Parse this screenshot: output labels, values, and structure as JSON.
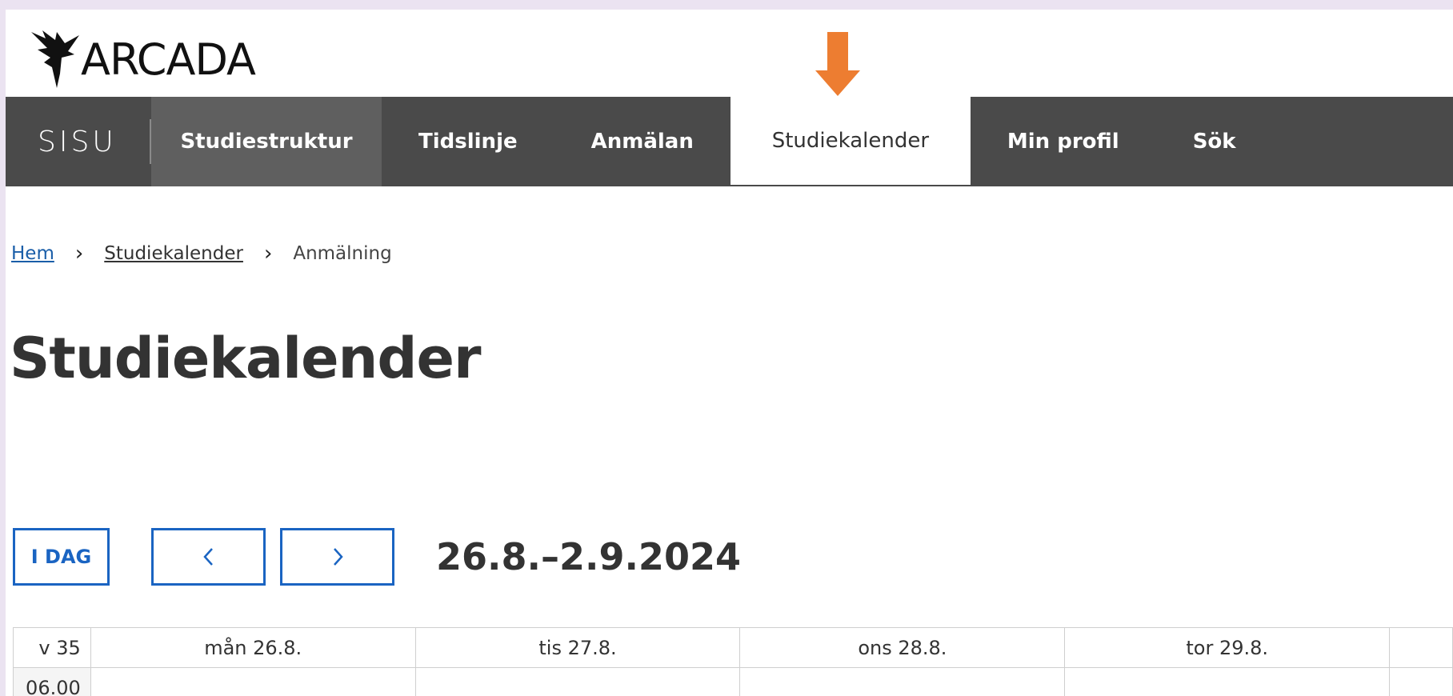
{
  "logo": {
    "text": "ARCADA",
    "icon": "arcada-bird-logo"
  },
  "annotation": {
    "icon": "orange-down-arrow",
    "color": "#ed7d31"
  },
  "nav": {
    "brand": "SISU",
    "items": [
      {
        "label": "Studiestruktur"
      },
      {
        "label": "Tidslinje"
      },
      {
        "label": "Anmälan"
      },
      {
        "label": "Studiekalender"
      },
      {
        "label": "Min profil"
      },
      {
        "label": "Sök"
      }
    ],
    "active": "Studiekalender"
  },
  "breadcrumb": {
    "home": "Hem",
    "section": "Studiekalender",
    "current": "Anmälning"
  },
  "page": {
    "title": "Studiekalender"
  },
  "calendar": {
    "today_label": "I DAG",
    "prev_icon": "chevron-left-icon",
    "next_icon": "chevron-right-icon",
    "range": "26.8.–2.9.2024",
    "week": "v 35",
    "days": [
      "mån 26.8.",
      "tis 27.8.",
      "ons 28.8.",
      "tor 29.8."
    ],
    "first_time": "06.00"
  },
  "colors": {
    "nav_bg": "#4a4a4a",
    "accent_blue": "#1a64c2",
    "link": "#1a5ea8",
    "frame": "#ebe3f1"
  }
}
